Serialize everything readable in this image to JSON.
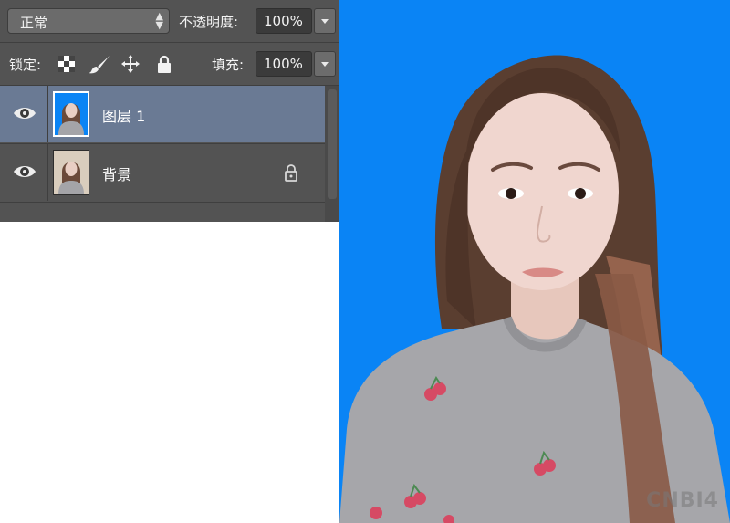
{
  "layers_panel": {
    "blend_mode": "正常",
    "opacity_label": "不透明度:",
    "opacity_value": "100%",
    "lock_label": "锁定:",
    "fill_label": "填充:",
    "fill_value": "100%",
    "lock_icons": [
      "lock-transparent-pixels-icon",
      "lock-image-pixels-icon",
      "lock-position-icon",
      "lock-all-icon"
    ],
    "layers": [
      {
        "name": "图层 1",
        "selected": true,
        "visible": true,
        "locked": false
      },
      {
        "name": "背景",
        "selected": false,
        "visible": true,
        "locked": true
      }
    ]
  },
  "canvas": {
    "background_color": "#0a84f5",
    "watermark_prefix": "",
    "watermark": "CNBI4"
  },
  "colors": {
    "panel": "#535353",
    "selected_layer": "#6a7a94",
    "photo_background": "#0a84f5"
  }
}
